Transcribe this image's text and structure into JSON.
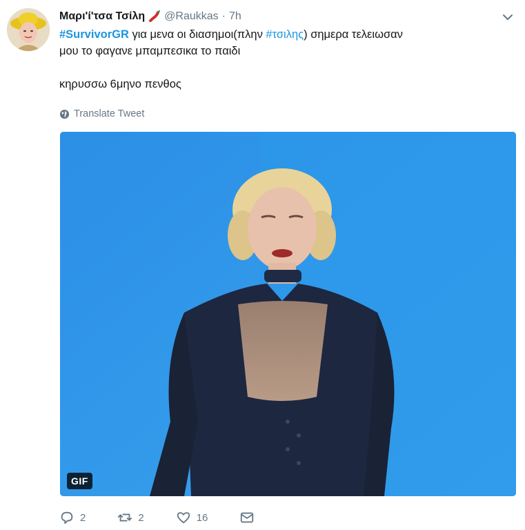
{
  "tweet": {
    "author_name": "Μαρι'ί'τσα Τσίλη",
    "handle": "@Raukkas",
    "separator": "·",
    "time": "7h",
    "text_line1_hashtag": "#SurvivorGR",
    "text_line1_mid": " για μενα οι διασημοι(πλην ",
    "text_line1_hashtag2": "#τσιλης",
    "text_line1_end": ") σημερα τελειωσαν",
    "text_line2": "μου το φαγανε μπαμπεσικα το παιδι",
    "text_line3": "κηρυσσω 6μηνο πενθος",
    "translate_label": "Translate Tweet"
  },
  "media": {
    "badge": "GIF"
  },
  "actions": {
    "replies": "2",
    "retweets": "2",
    "likes": "16"
  },
  "icons": {
    "reply": "reply-icon",
    "retweet": "retweet-icon",
    "like": "heart-icon",
    "dm": "envelope-icon",
    "menu": "chevron-down-icon",
    "translate": "globe-icon",
    "emoji": "hot-pepper-icon"
  },
  "colors": {
    "link": "#1b95e0",
    "secondary": "#657786",
    "media_background": "#2f9be8"
  }
}
